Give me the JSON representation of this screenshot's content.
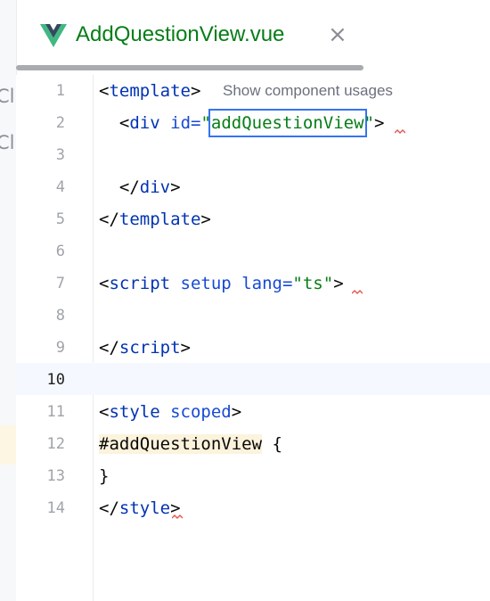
{
  "tab": {
    "file_name": "AddQuestionView.vue",
    "close_symbol": "×",
    "icon": "vue-icon"
  },
  "side_panel": {
    "fragments": [
      "Cl",
      "Cl"
    ]
  },
  "editor": {
    "current_line": 10,
    "hint_text": "Show component usages",
    "line_numbers": [
      "1",
      "2",
      "3",
      "4",
      "5",
      "6",
      "7",
      "8",
      "9",
      "10",
      "11",
      "12",
      "13",
      "14"
    ],
    "lines": {
      "l1": {
        "open": "<",
        "tag": "template",
        "close": ">"
      },
      "l2": {
        "indent": "  ",
        "open": "<",
        "tag": "div",
        "attr": "id",
        "eq": "=",
        "q1": "\"",
        "value": "addQuestionView",
        "q2": "\"",
        "close": ">"
      },
      "l4": {
        "indent": "  ",
        "open": "</",
        "tag": "div",
        "close": ">"
      },
      "l5": {
        "open": "</",
        "tag": "template",
        "close": ">"
      },
      "l7": {
        "open": "<",
        "tag": "script",
        "attr1": "setup",
        "attr2": "lang",
        "eq": "=",
        "value": "\"ts\"",
        "close": ">"
      },
      "l9": {
        "open": "</",
        "tag": "script",
        "close": ">"
      },
      "l11": {
        "open": "<",
        "tag": "style",
        "attr": "scoped",
        "close": ">"
      },
      "l12": {
        "selector": "#addQuestionView",
        "brace": " {"
      },
      "l13": {
        "brace": "}"
      },
      "l14": {
        "open": "</",
        "tag": "style",
        "close": ">"
      }
    }
  },
  "colors": {
    "tag": "#0033b3",
    "attribute": "#174ad4",
    "string": "#067d17",
    "file_name": "#067d17",
    "error_squiggle": "#e55353",
    "rename_box": "#3574f0"
  }
}
